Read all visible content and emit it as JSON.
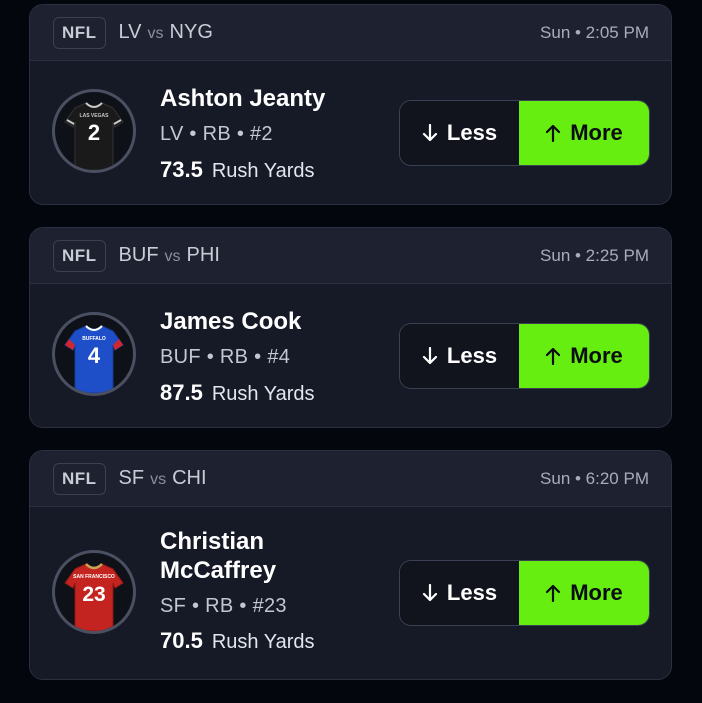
{
  "colors": {
    "background": "#04060d",
    "card": "#161a26",
    "card_header": "#1e2230",
    "more_accent": "#66ee11"
  },
  "picks": [
    {
      "league": "NFL",
      "home": "LV",
      "vs": "vs",
      "away": "NYG",
      "time": "Sun • 2:05 PM",
      "player_name": "Ashton Jeanty",
      "player_meta": "LV • RB • #2",
      "line_value": "73.5",
      "stat": "Rush Yards",
      "less_label": "Less",
      "more_label": "More",
      "jersey": {
        "number": "2",
        "team_text": "LAS VEGAS",
        "color": "#1a1a1a",
        "accent": "#c8c8c8"
      }
    },
    {
      "league": "NFL",
      "home": "BUF",
      "vs": "vs",
      "away": "PHI",
      "time": "Sun • 2:25 PM",
      "player_name": "James Cook",
      "player_meta": "BUF • RB • #4",
      "line_value": "87.5",
      "stat": "Rush Yards",
      "less_label": "Less",
      "more_label": "More",
      "jersey": {
        "number": "4",
        "team_text": "BUFFALO",
        "color": "#1f4fc8",
        "accent": "#d0262f"
      }
    },
    {
      "league": "NFL",
      "home": "SF",
      "vs": "vs",
      "away": "CHI",
      "time": "Sun • 6:20 PM",
      "player_name_line1": "Christian",
      "player_name_line2": "McCaffrey",
      "player_meta": "SF • RB • #23",
      "line_value": "70.5",
      "stat": "Rush Yards",
      "less_label": "Less",
      "more_label": "More",
      "jersey": {
        "number": "23",
        "team_text": "SAN FRANCISCO",
        "color": "#c4241f",
        "accent": "#c9a35a"
      }
    }
  ]
}
